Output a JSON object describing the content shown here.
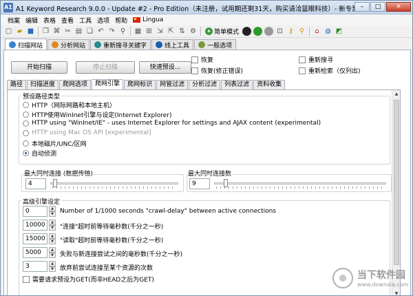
{
  "window": {
    "icon_text": "A1",
    "title": "A1 Keyword Research 9.0.0 - Update #2 - Pro Edition（未注册，试用期还剩31天，购买请洽篮眼科技）- 新专案",
    "min": "–",
    "max": "□",
    "close": "✕"
  },
  "menu": [
    "档案",
    "编辑",
    "表格",
    "查看",
    "工具",
    "选项",
    "帮助"
  ],
  "menu_lingua": "Lingua",
  "toolbar": {
    "simple_mode": "简单模式"
  },
  "main_tabs": [
    "扫描网站",
    "分析网站",
    "重新搜寻关键字",
    "线上工具",
    "一般选项"
  ],
  "actions": {
    "start_scan": "开始扫描",
    "stop_scan": "停止扫描",
    "quick_preset": "快速预设...",
    "resume": "恢复",
    "resume_fix": "恢复(修正错误)",
    "re_search": "重新搜寻",
    "re_check": "重新检索（仅列出)"
  },
  "sub_tabs": [
    "路径",
    "扫描进度",
    "爬网选项",
    "爬网引擎",
    "爬网标识",
    "网管过滤",
    "分析过滤",
    "列表过滤",
    "资料收集"
  ],
  "preset_path": {
    "title": "预设路径类型",
    "options": [
      "HTTP（网际网路和本地主机）",
      "HTTP使用WinInet引擎与设定(Internet Explorer)",
      "HTTP using \"WinInet/IE\" - uses Internet Explorer for settings and AJAX content (experimental)",
      "HTTP using Mac OS API [experimental]",
      "本地磁片/UNC/区网",
      "自动侦测"
    ]
  },
  "max_conn_transfer": {
    "label": "最大同时连接 (数据传输)",
    "value": "4"
  },
  "max_conn": {
    "label": "最大同时连接数",
    "value": "9"
  },
  "advanced": {
    "title": "高级引擎设定",
    "rows": [
      {
        "value": "0",
        "label": "Number of 1/1000 seconds \"crawl-delay\" between active connections"
      },
      {
        "value": "10000",
        "label": "\"连接\"超时前等待毫秒数(千分之一秒)"
      },
      {
        "value": "15000",
        "label": "\"读取\"超时前等待毫秒数(千分之一秒)"
      },
      {
        "value": "5000",
        "label": "失败与新连接尝试之间的毫秒数(千分之一秒)"
      },
      {
        "value": "3",
        "label": "放弃前尝试连接至某个资源的次数"
      }
    ],
    "last_check": "需要请求预设为GET(而非HEAD之后为GET)"
  },
  "watermark": {
    "t1": "当下软件园",
    "t2": "www.downxia.com"
  }
}
